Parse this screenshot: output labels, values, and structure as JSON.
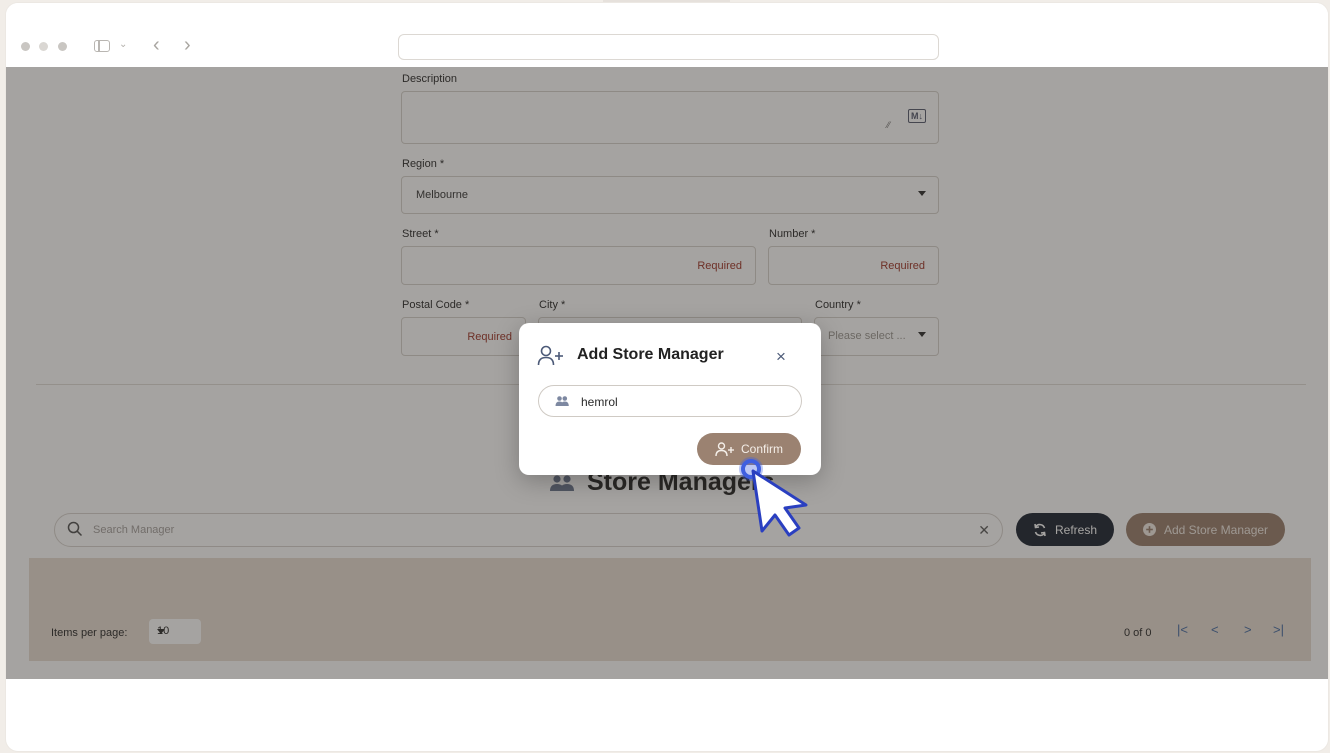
{
  "form": {
    "description_label": "Description",
    "md_badge": "M↓",
    "region_label": "Region *",
    "region_value": "Melbourne",
    "street_label": "Street *",
    "street_hint": "Required",
    "number_label": "Number *",
    "number_hint": "Required",
    "postal_label": "Postal Code *",
    "postal_hint": "Required",
    "city_label": "City *",
    "country_label": "Country *",
    "country_placeholder": "Please select ..."
  },
  "managers": {
    "title": "Store Managers",
    "search_placeholder": "Search Manager",
    "refresh_label": "Refresh",
    "add_label": "Add Store Manager",
    "items_per_page_label": "Items per page:",
    "items_per_page_value": "10",
    "range_label": "0 of 0",
    "first_page": "|<",
    "prev_page": "<",
    "next_page": ">",
    "last_page": ">|"
  },
  "dialog": {
    "title": "Add Store Manager",
    "close_glyph": "×",
    "input_value": "hemrol",
    "confirm_label": "Confirm"
  },
  "colors": {
    "accent_brown": "#9b8271",
    "dark_button": "#1f2936",
    "required_red": "#a03a2e",
    "cursor_blue": "#3f5fe0"
  }
}
